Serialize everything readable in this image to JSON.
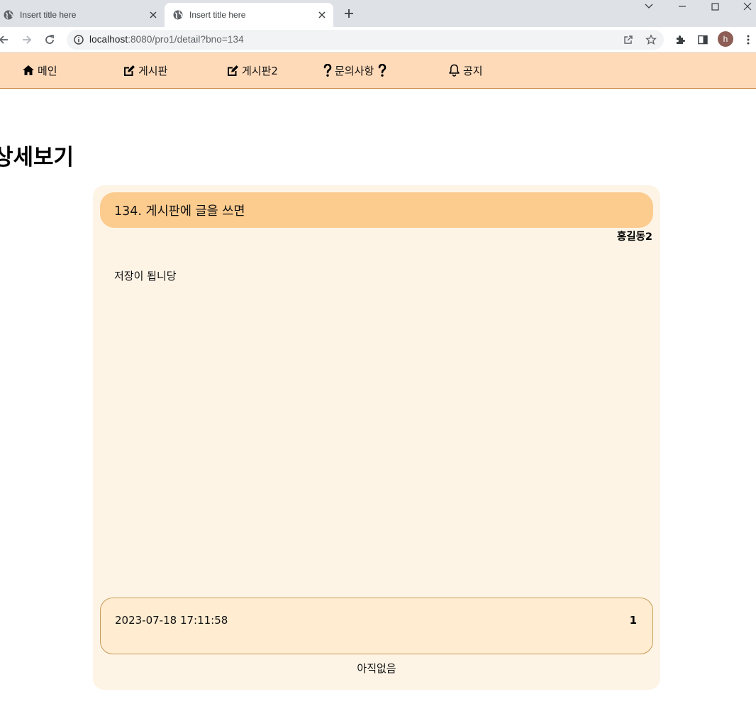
{
  "browser": {
    "tabs": [
      {
        "title": "Insert title here",
        "active": false
      },
      {
        "title": "Insert title here",
        "active": true
      }
    ],
    "address_host": "localhost",
    "address_path": ":8080/pro1/detail?bno=134",
    "profile_initial": "h"
  },
  "nav": {
    "items": [
      {
        "label": "메인",
        "icon": "home-icon"
      },
      {
        "label": "게시판",
        "icon": "edit-icon"
      },
      {
        "label": "게시판2",
        "icon": "edit-icon"
      },
      {
        "label": "문의사항",
        "icon": "question-icon"
      },
      {
        "label": "공지",
        "icon": "bell-icon"
      }
    ]
  },
  "page": {
    "title": "상세보기"
  },
  "post": {
    "title": "134. 게시판에 글을 쓰면",
    "author": "홍길동2",
    "content": "저장이 됩니당",
    "date": "2023-07-18 17:11:58",
    "count": "1",
    "reply_status": "아직없음"
  },
  "colors": {
    "nav_bg": "#ffdab9",
    "card_bg": "#fdf4e6",
    "title_bar": "#fccb8e",
    "meta_bg": "#ffecd1"
  }
}
